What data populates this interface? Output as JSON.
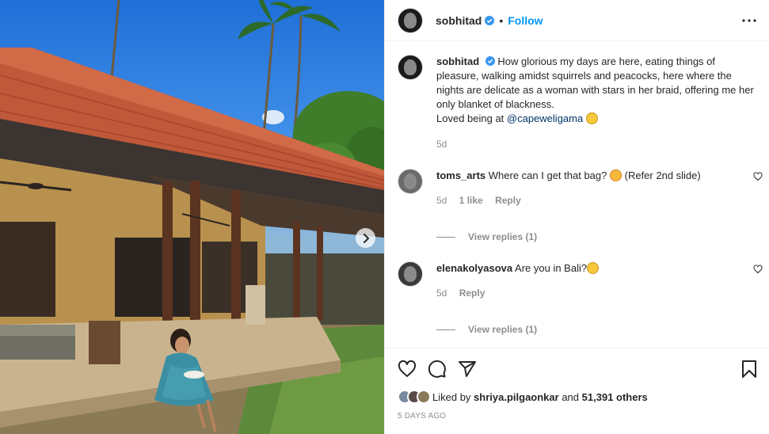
{
  "post": {
    "author": "sobhitad",
    "follow_label": "Follow",
    "separator": "•"
  },
  "caption": {
    "username": "sobhitad",
    "text": "How glorious my days are here, eating things of pleasure, walking amidst squirrels and peacocks, here where the nights are delicate as a woman with stars in her braid, offering me her only blanket of blackness.",
    "line2_prefix": "Loved being at ",
    "mention": "@capeweligama",
    "time": "5d"
  },
  "comments": [
    {
      "username": "toms_arts",
      "text_before": "Where can I get that bag?",
      "text_after": "(Refer 2nd slide)",
      "time": "5d",
      "likes": "1 like",
      "reply_label": "Reply",
      "view_replies": "View replies (1)"
    },
    {
      "username": "elenakolyasova",
      "text_before": "Are you in Bali?",
      "text_after": "",
      "time": "5d",
      "reply_label": "Reply",
      "view_replies": "View replies (1)"
    }
  ],
  "likes": {
    "prefix": "Liked by",
    "user": "shriya.pilgaonkar",
    "mid": "and",
    "count": "51,391 others"
  },
  "timestamp": "5 DAYS AGO",
  "colors": {
    "accent": "#0095f6",
    "verified": "#3897f0",
    "muted": "#8e8e8e"
  },
  "icons": [
    "verified-icon",
    "more-icon",
    "heart-icon",
    "comment-icon",
    "share-icon",
    "bookmark-icon",
    "next-arrow-icon"
  ]
}
